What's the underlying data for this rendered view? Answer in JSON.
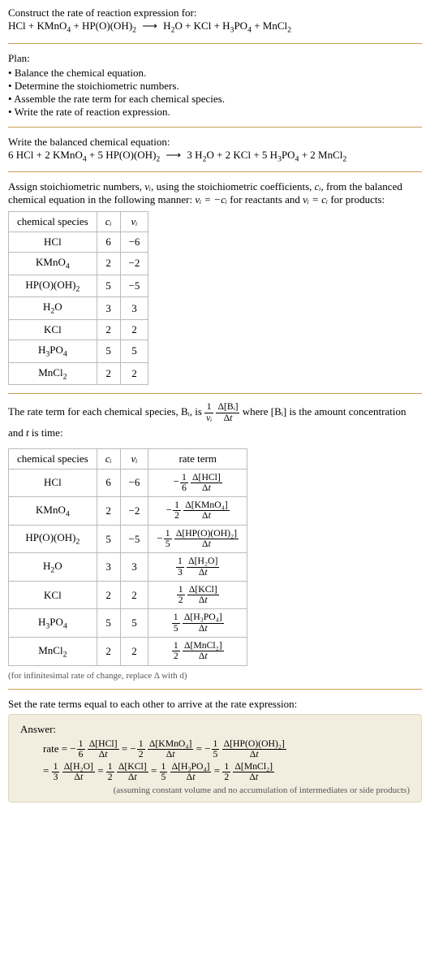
{
  "intro": {
    "construct": "Construct the rate of reaction expression for:",
    "eq_lhs": "HCl + KMnO₄ + HP(O)(OH)₂",
    "arrow": "⟶",
    "eq_rhs": "H₂O + KCl + H₃PO₄ + MnCl₂"
  },
  "plan": {
    "heading": "Plan:",
    "items": [
      "Balance the chemical equation.",
      "Determine the stoichiometric numbers.",
      "Assemble the rate term for each chemical species.",
      "Write the rate of reaction expression."
    ]
  },
  "balanced": {
    "heading": "Write the balanced chemical equation:",
    "lhs": "6 HCl + 2 KMnO₄ + 5 HP(O)(OH)₂",
    "arrow": "⟶",
    "rhs": "3 H₂O + 2 KCl + 5 H₃PO₄ + 2 MnCl₂"
  },
  "stoich": {
    "intro_a": "Assign stoichiometric numbers, ",
    "nu_i": "νᵢ",
    "intro_b": ", using the stoichiometric coefficients, ",
    "c_i": "cᵢ",
    "intro_c": ", from the balanced chemical equation in the following manner: ",
    "rel_react": "νᵢ = −cᵢ",
    "intro_d": " for reactants and ",
    "rel_prod": "νᵢ = cᵢ",
    "intro_e": " for products:",
    "headers": {
      "sp": "chemical species",
      "c": "cᵢ",
      "nu": "νᵢ"
    },
    "rows": [
      {
        "sp": "HCl",
        "c": "6",
        "nu": "−6"
      },
      {
        "sp": "KMnO₄",
        "c": "2",
        "nu": "−2"
      },
      {
        "sp": "HP(O)(OH)₂",
        "c": "5",
        "nu": "−5"
      },
      {
        "sp": "H₂O",
        "c": "3",
        "nu": "3"
      },
      {
        "sp": "KCl",
        "c": "2",
        "nu": "2"
      },
      {
        "sp": "H₃PO₄",
        "c": "5",
        "nu": "5"
      },
      {
        "sp": "MnCl₂",
        "c": "2",
        "nu": "2"
      }
    ]
  },
  "rateterm": {
    "intro_a": "The rate term for each chemical species, Bᵢ, is ",
    "intro_b": " where [Bᵢ] is the amount concentration and ",
    "t": "t",
    "intro_c": " is time:",
    "headers": {
      "sp": "chemical species",
      "c": "cᵢ",
      "nu": "νᵢ",
      "rt": "rate term"
    },
    "rows": [
      {
        "sp": "HCl",
        "c": "6",
        "nu": "−6",
        "sign": "−",
        "den": "6",
        "dnum": "Δ[HCl]"
      },
      {
        "sp": "KMnO₄",
        "c": "2",
        "nu": "−2",
        "sign": "−",
        "den": "2",
        "dnum": "Δ[KMnO₄]"
      },
      {
        "sp": "HP(O)(OH)₂",
        "c": "5",
        "nu": "−5",
        "sign": "−",
        "den": "5",
        "dnum": "Δ[HP(O)(OH)₂]"
      },
      {
        "sp": "H₂O",
        "c": "3",
        "nu": "3",
        "sign": "",
        "den": "3",
        "dnum": "Δ[H₂O]"
      },
      {
        "sp": "KCl",
        "c": "2",
        "nu": "2",
        "sign": "",
        "den": "2",
        "dnum": "Δ[KCl]"
      },
      {
        "sp": "H₃PO₄",
        "c": "5",
        "nu": "5",
        "sign": "",
        "den": "5",
        "dnum": "Δ[H₃PO₄]"
      },
      {
        "sp": "MnCl₂",
        "c": "2",
        "nu": "2",
        "sign": "",
        "den": "2",
        "dnum": "Δ[MnCl₂]"
      }
    ],
    "note": "(for infinitesimal rate of change, replace Δ with d)"
  },
  "final": {
    "heading": "Set the rate terms equal to each other to arrive at the rate expression:",
    "answer_label": "Answer:",
    "rate_label": "rate",
    "terms_line1": [
      {
        "pre": " = ",
        "sign": "−",
        "den": "6",
        "dnum": "Δ[HCl]"
      },
      {
        "pre": " = ",
        "sign": "−",
        "den": "2",
        "dnum": "Δ[KMnO₄]"
      },
      {
        "pre": " = ",
        "sign": "−",
        "den": "5",
        "dnum": "Δ[HP(O)(OH)₂]"
      }
    ],
    "terms_line2": [
      {
        "pre": " = ",
        "sign": "",
        "den": "3",
        "dnum": "Δ[H₂O]"
      },
      {
        "pre": " = ",
        "sign": "",
        "den": "2",
        "dnum": "Δ[KCl]"
      },
      {
        "pre": " = ",
        "sign": "",
        "den": "5",
        "dnum": "Δ[H₃PO₄]"
      },
      {
        "pre": " = ",
        "sign": "",
        "den": "2",
        "dnum": "Δ[MnCl₂]"
      }
    ],
    "note": "(assuming constant volume and no accumulation of intermediates or side products)"
  },
  "dt": "Δt",
  "one": "1"
}
